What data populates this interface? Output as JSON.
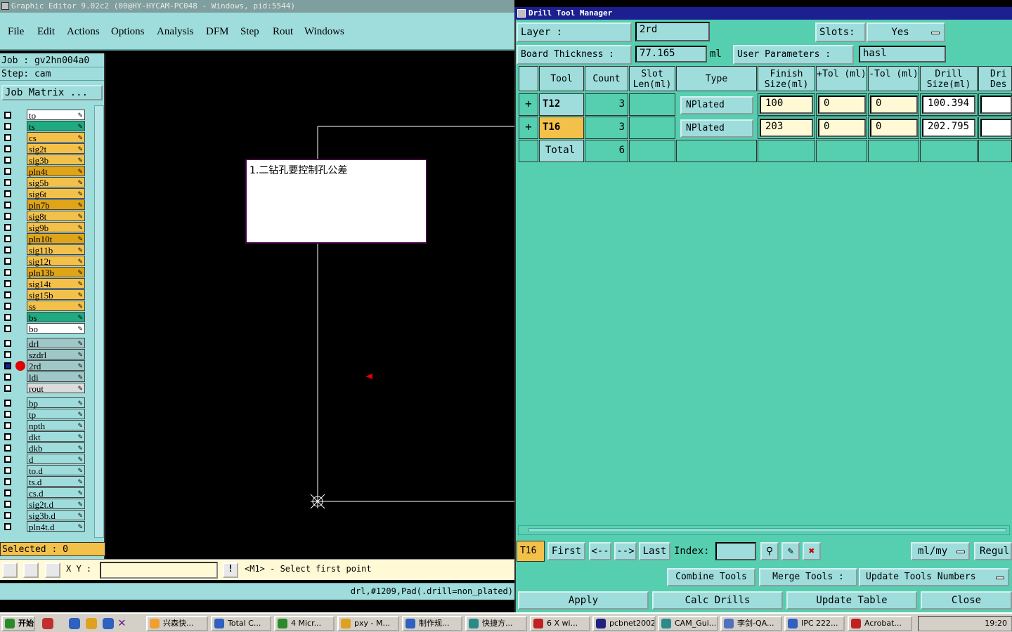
{
  "editor": {
    "title": "Graphic Editor 9.02c2 (00@HY-HYCAM-PC048 - Windows, pid:5544)",
    "menu": [
      "File",
      "Edit",
      "Actions",
      "Options",
      "Analysis",
      "DFM",
      "Step",
      "Rout",
      "Windows"
    ],
    "job_label": "Job : gv2hn004a0",
    "step_label": "Step: cam",
    "job_matrix": "Job Matrix ...",
    "layers_board": [
      {
        "name": "to",
        "color": "#ffffff"
      },
      {
        "name": "ts",
        "color": "#1faa80"
      },
      {
        "name": "cs",
        "color": "#f3c14a"
      },
      {
        "name": "sig2t",
        "color": "#f3c14a"
      },
      {
        "name": "sig3b",
        "color": "#f3c14a"
      },
      {
        "name": "pln4t",
        "color": "#e0a418"
      },
      {
        "name": "sig5b",
        "color": "#f3c14a"
      },
      {
        "name": "sig6t",
        "color": "#f3c14a"
      },
      {
        "name": "pln7b",
        "color": "#e0a418"
      },
      {
        "name": "sig8t",
        "color": "#f3c14a"
      },
      {
        "name": "sig9b",
        "color": "#f3c14a"
      },
      {
        "name": "pln10t",
        "color": "#e0a418"
      },
      {
        "name": "sig11b",
        "color": "#f3c14a"
      },
      {
        "name": "sig12t",
        "color": "#f3c14a"
      },
      {
        "name": "pln13b",
        "color": "#e0a418"
      },
      {
        "name": "sig14t",
        "color": "#f3c14a"
      },
      {
        "name": "sig15b",
        "color": "#f3c14a"
      },
      {
        "name": "ss",
        "color": "#f3c14a"
      },
      {
        "name": "bs",
        "color": "#1faa80"
      },
      {
        "name": "bo",
        "color": "#ffffff"
      }
    ],
    "layers_drill": [
      {
        "name": "drl",
        "color": "#9fc7c7"
      },
      {
        "name": "szdrl",
        "color": "#9fc7c7"
      },
      {
        "name": "2rd",
        "color": "#9fc7c7",
        "active": true
      },
      {
        "name": "ldi",
        "color": "#9fc7c7"
      },
      {
        "name": "rout",
        "color": "#dcdcdc"
      }
    ],
    "layers_misc": [
      {
        "name": "bp",
        "color": "#9fdcdc"
      },
      {
        "name": "tp",
        "color": "#9fdcdc"
      },
      {
        "name": "npth",
        "color": "#9fdcdc"
      },
      {
        "name": "dkt",
        "color": "#9fdcdc"
      },
      {
        "name": "dkb",
        "color": "#9fdcdc"
      },
      {
        "name": "d",
        "color": "#9fdcdc"
      },
      {
        "name": "to.d",
        "color": "#9fdcdc"
      },
      {
        "name": "ts.d",
        "color": "#9fdcdc"
      },
      {
        "name": "cs.d",
        "color": "#9fdcdc"
      },
      {
        "name": "sig2t.d",
        "color": "#9fdcdc"
      },
      {
        "name": "sig3b.d",
        "color": "#9fdcdc"
      },
      {
        "name": "pln4t.d",
        "color": "#9fdcdc"
      }
    ],
    "selected": "Selected : 0",
    "note_text": "1.二钻孔要控制孔公差",
    "xy_label": "X Y :",
    "prompt": "<M1> - Select first point",
    "status": "drl,#1209,Pad(.drill=non_plated)"
  },
  "dtm": {
    "title": "Drill Tool Manager",
    "layer_label": "Layer          :",
    "layer_value": "2rd",
    "slots_label": "Slots:",
    "slots_value": "Yes",
    "board_thickness_label": "Board Thickness :",
    "board_thickness_value": "77.165",
    "board_thickness_unit": "ml",
    "user_params_label": "User Parameters :",
    "user_params_value": "hasl",
    "columns": [
      "Tool",
      "Count",
      "Slot Len(ml)",
      "Type",
      "Finish Size(ml)",
      "+Tol (ml)",
      "-Tol (ml)",
      "Drill Size(ml)",
      "Dri Des"
    ],
    "rows": [
      {
        "tool": "T12",
        "count": "3",
        "type": "NPlated",
        "finish": "100",
        "ptol": "0",
        "mtol": "0",
        "drill": "100.394"
      },
      {
        "tool": "T16",
        "count": "3",
        "type": "NPlated",
        "finish": "203",
        "ptol": "0",
        "mtol": "0",
        "drill": "202.795"
      }
    ],
    "total_label": "Total",
    "total_count": "6",
    "current_tool": "T16",
    "nav": {
      "first": "First",
      "prev": "<--",
      "next": "-->",
      "last": "Last",
      "index": "Index:"
    },
    "units": "ml/my",
    "regul": "Regul",
    "combine": "Combine Tools",
    "merge": "Merge Tools :",
    "update_numbers": "Update Tools Numbers",
    "apply": "Apply",
    "calc": "Calc Drills",
    "update_table": "Update Table",
    "close": "Close"
  },
  "taskbar": {
    "start": "开始",
    "items": [
      "兴森快...",
      "Total C...",
      "4 Micr...",
      "pxy - M...",
      "制作规...",
      "快捷方...",
      "6 X wi...",
      "pcbnet2002",
      "CAM_Gui...",
      "李剑-QA...",
      "IPC 222...",
      "Acrobat..."
    ],
    "clock": "19:20"
  }
}
